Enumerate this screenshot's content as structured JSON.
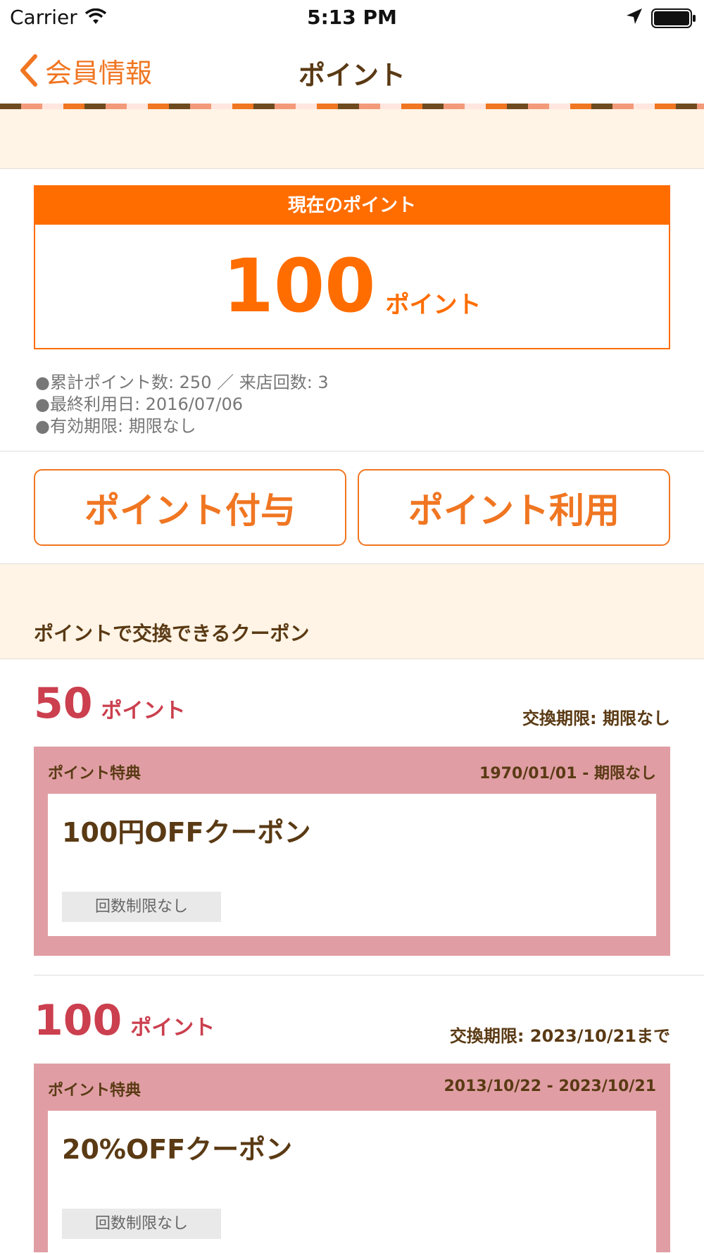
{
  "status_bar": {
    "carrier": "Carrier",
    "time": "5:13 PM"
  },
  "nav": {
    "back_label": "会員情報",
    "title": "ポイント"
  },
  "current_points": {
    "header": "現在のポイント",
    "value": "100",
    "unit": "ポイント"
  },
  "info_lines": [
    "●累計ポイント数: 250 ／ 来店回数: 3",
    "●最終利用日: 2016/07/06",
    "●有効期限: 期限なし"
  ],
  "buttons": {
    "grant": "ポイント付与",
    "use": "ポイント利用"
  },
  "section": {
    "title": "ポイントで交換できるクーポン"
  },
  "coupons": [
    {
      "points": "50",
      "unit": "ポイント",
      "expiry": "交換期限: 期限なし",
      "label": "ポイント特典",
      "period": "1970/01/01 - 期限なし",
      "title": "100円OFFクーポン",
      "limit": "回数制限なし"
    },
    {
      "points": "100",
      "unit": "ポイント",
      "expiry": "交換期限: 2023/10/21まで",
      "label": "ポイント特典",
      "period": "2013/10/22 - 2023/10/21",
      "title": "20%OFFクーポン",
      "limit": "回数制限なし"
    }
  ],
  "colors": {
    "accent": "#ff6d00",
    "brown": "#5a3a14",
    "coupon_red": "#cb3f4e",
    "coupon_bg": "#e09ea4",
    "cream": "#fff4e6"
  }
}
